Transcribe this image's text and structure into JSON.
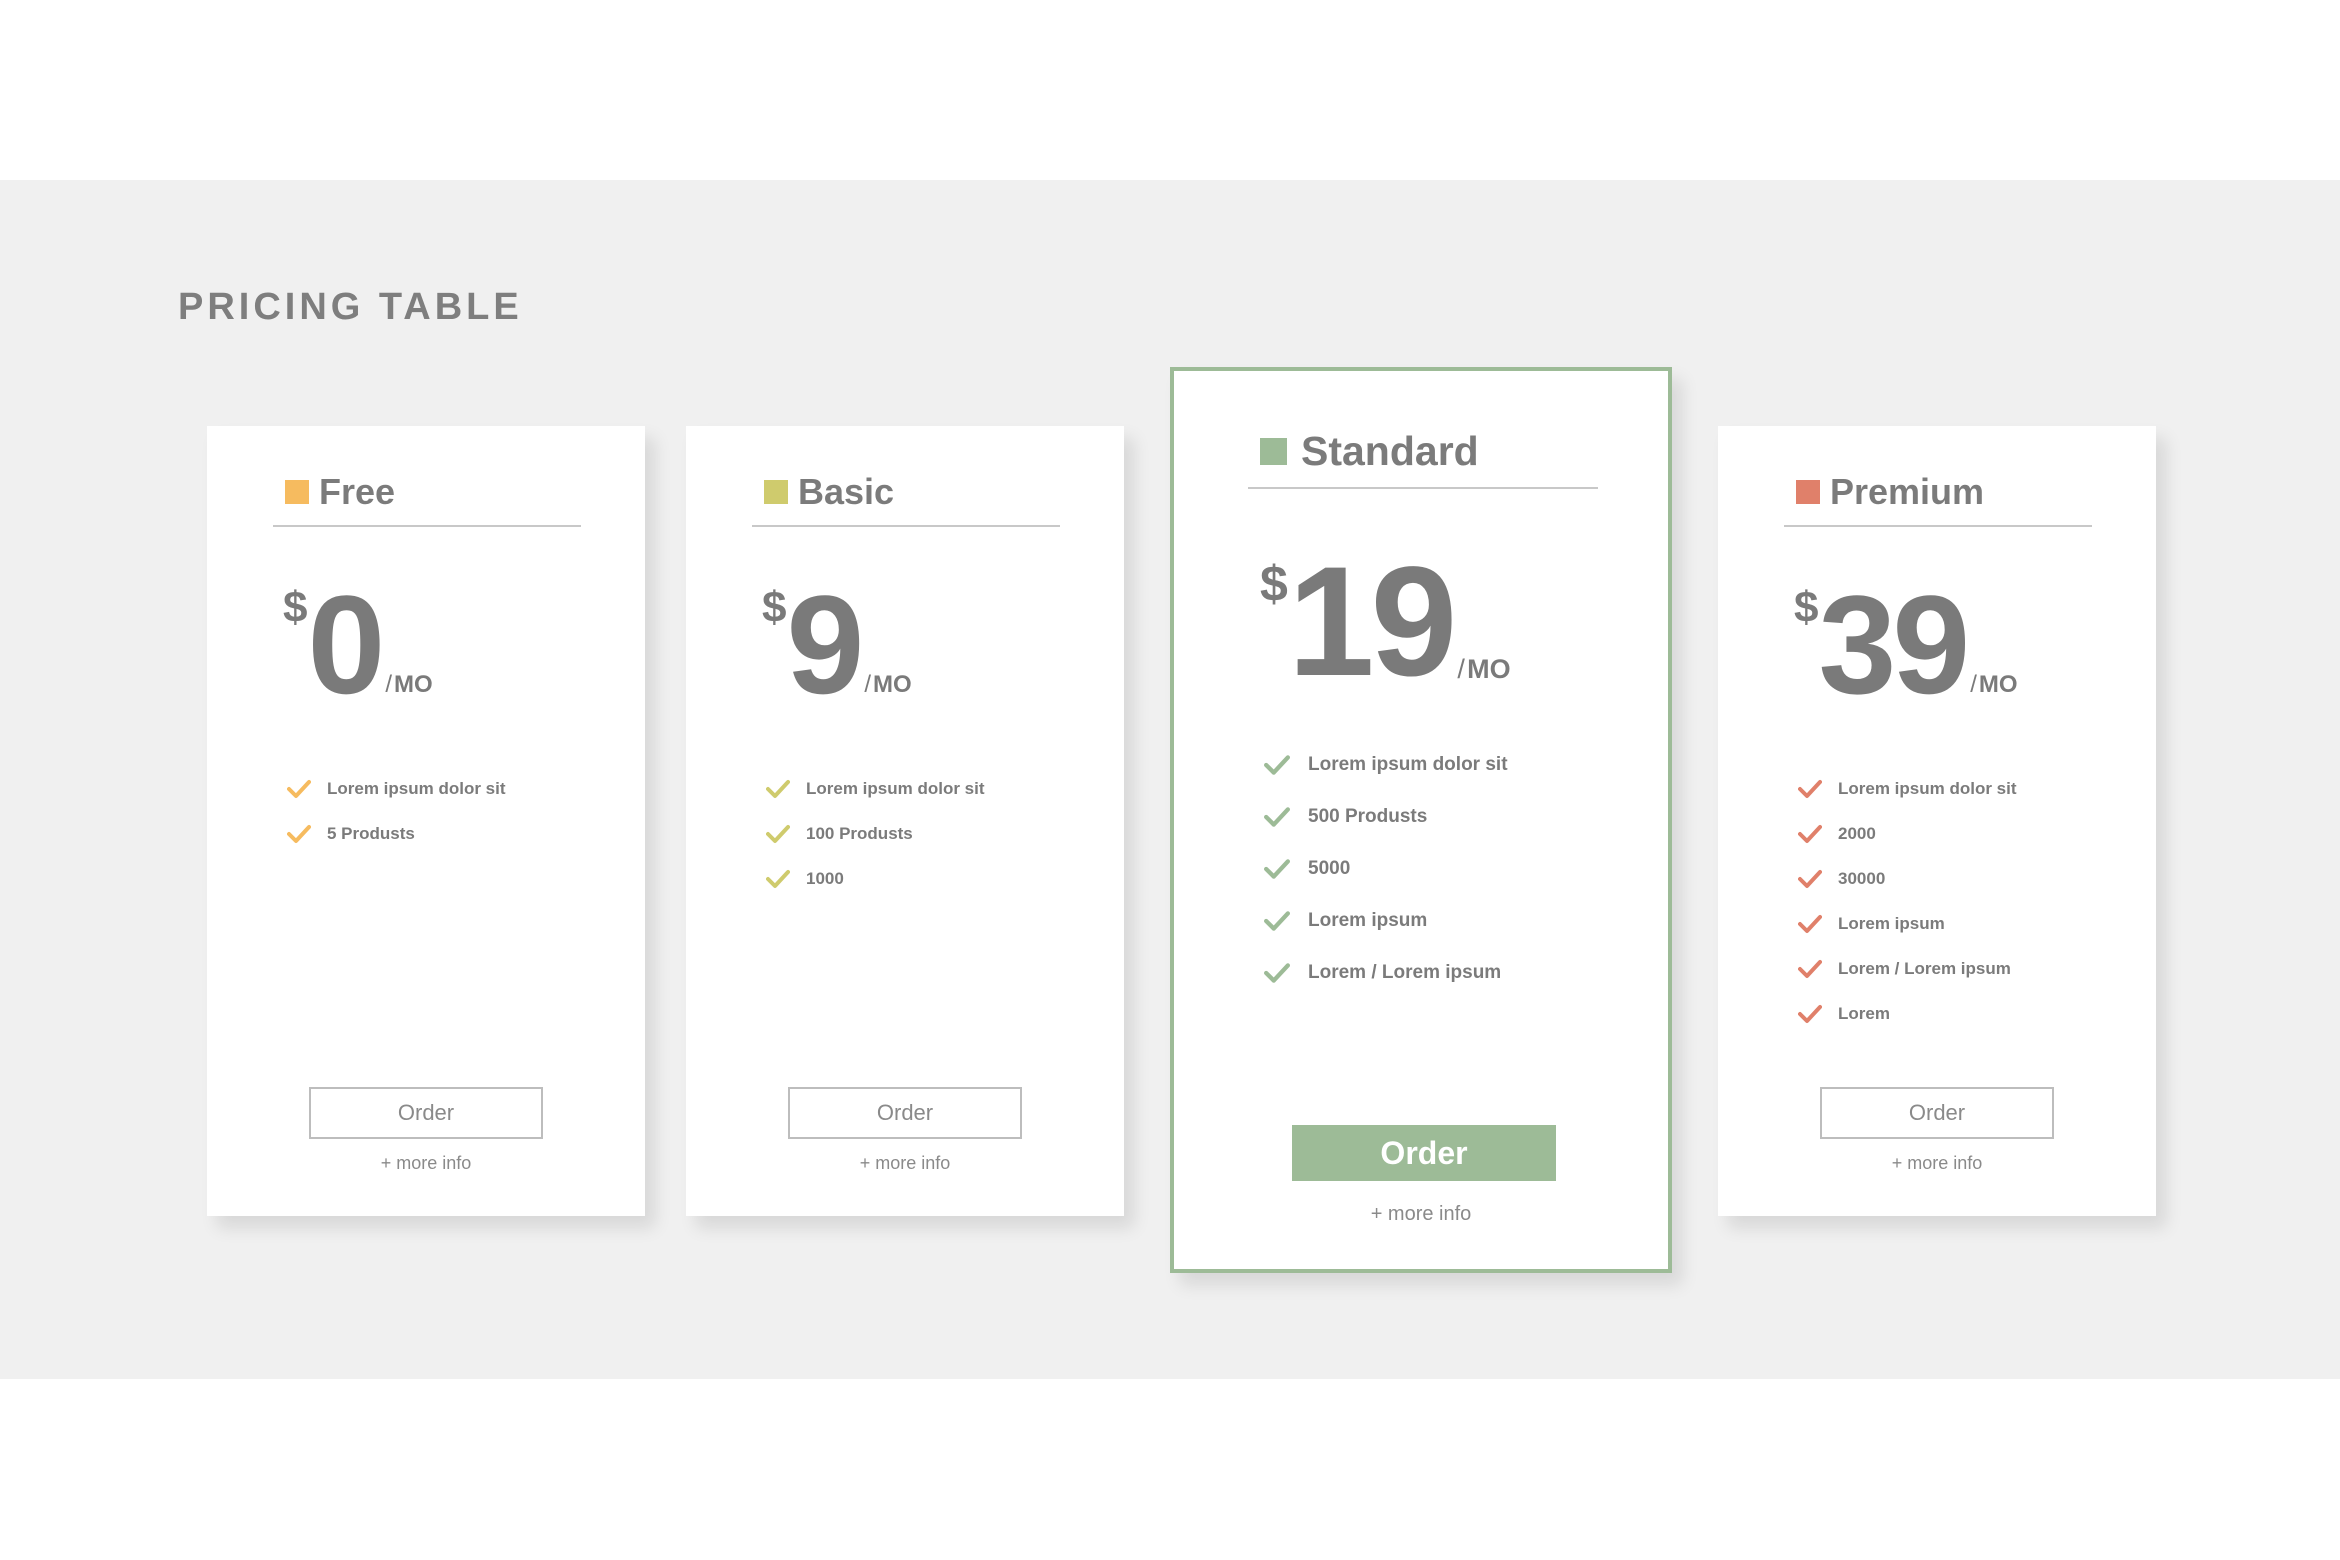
{
  "section": {
    "title": "PRICING TABLE"
  },
  "colors": {
    "background_band": "#f0f0f0",
    "card": "#ffffff",
    "text": "#7b7b7b",
    "free_accent": "#f6bb5f",
    "basic_accent": "#cfcb6d",
    "standard_accent": "#9dbb97",
    "premium_accent": "#e0806a"
  },
  "plans": [
    {
      "name": "Free",
      "accent": "#f6bb5f",
      "currency": "$",
      "amount": "0",
      "period_slash": "/",
      "period_unit": "MO",
      "features": [
        "Lorem ipsum dolor sit",
        "5  Produsts"
      ],
      "order_label": "Order",
      "more_info": "+ more info",
      "featured": false
    },
    {
      "name": "Basic",
      "accent": "#cfcb6d",
      "currency": "$",
      "amount": "9",
      "period_slash": "/",
      "period_unit": "MO",
      "features": [
        "Lorem ipsum dolor sit",
        "100 Produsts",
        "1000"
      ],
      "order_label": "Order",
      "more_info": "+ more info",
      "featured": false
    },
    {
      "name": "Standard",
      "accent": "#9dbb97",
      "currency": "$",
      "amount": "19",
      "period_slash": "/",
      "period_unit": "MO",
      "features": [
        "Lorem ipsum dolor sit",
        "500 Produsts",
        "5000",
        "Lorem ipsum",
        "Lorem / Lorem ipsum"
      ],
      "order_label": "Order",
      "more_info": "+ more info",
      "featured": true
    },
    {
      "name": "Premium",
      "accent": "#e0806a",
      "currency": "$",
      "amount": "39",
      "period_slash": "/",
      "period_unit": "MO",
      "features": [
        "Lorem ipsum dolor sit",
        "2000",
        "30000",
        "Lorem ipsum",
        "Lorem / Lorem ipsum",
        "Lorem"
      ],
      "order_label": "Order",
      "more_info": "+ more info",
      "featured": false
    }
  ]
}
